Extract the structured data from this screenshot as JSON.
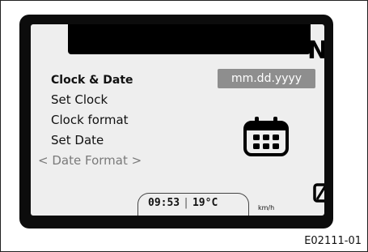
{
  "display": {
    "gear": "N",
    "menu": {
      "title": "Clock & Date",
      "items": [
        {
          "label": "Set Clock"
        },
        {
          "label": "Clock format"
        },
        {
          "label": "Set Date"
        },
        {
          "label": "Date Format",
          "prefix": "<",
          "suffix": ">",
          "selected": true
        }
      ]
    },
    "date_format_value": "mm.dd.yyyy",
    "center_icon": "calendar-icon",
    "status": {
      "time": "09:53",
      "separator": "|",
      "temperature": "19°C",
      "speed_unit": "km/h"
    },
    "mode_icon": "slashed-zero-icon"
  },
  "figure_ref": "E02111-01",
  "colors": {
    "screen_bg": "#eeeeee",
    "bezel": "#0c0c0c",
    "value_box": "#8e8e8e",
    "disabled_text": "#7a7a7a"
  }
}
